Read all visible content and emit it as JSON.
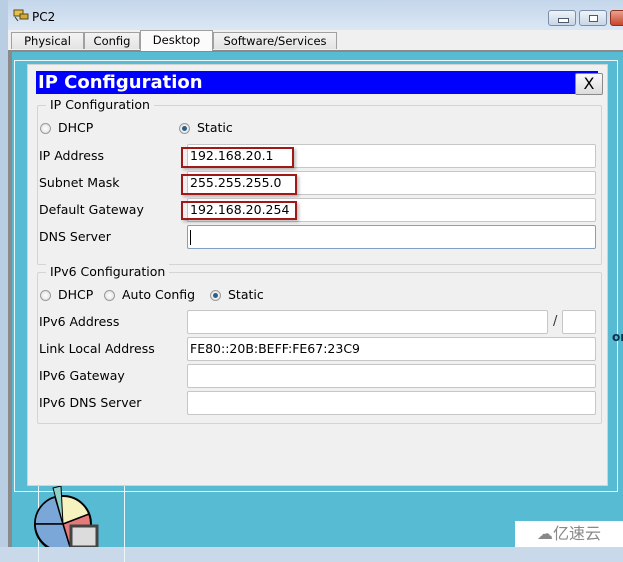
{
  "window": {
    "title": "PC2",
    "icon": "pc-device-icon",
    "controls": [
      "minimize",
      "maximize",
      "close"
    ]
  },
  "tabs": [
    {
      "label": "Physical",
      "active": false
    },
    {
      "label": "Config",
      "active": false
    },
    {
      "label": "Desktop",
      "active": true
    },
    {
      "label": "Software/Services",
      "active": false
    }
  ],
  "dialog": {
    "title": "IP Configuration",
    "close_label": "X",
    "ipv4": {
      "legend": "IP Configuration",
      "mode_options": [
        {
          "label": "DHCP",
          "selected": false
        },
        {
          "label": "Static",
          "selected": true
        }
      ],
      "fields": [
        {
          "label": "IP Address",
          "value": "192.168.20.1",
          "highlighted": true
        },
        {
          "label": "Subnet Mask",
          "value": "255.255.255.0",
          "highlighted": true
        },
        {
          "label": "Default Gateway",
          "value": "192.168.20.254",
          "highlighted": true
        },
        {
          "label": "DNS Server",
          "value": "",
          "highlighted": false,
          "focused": true
        }
      ]
    },
    "ipv6": {
      "legend": "IPv6 Configuration",
      "mode_options": [
        {
          "label": "DHCP",
          "selected": false
        },
        {
          "label": "Auto Config",
          "selected": false
        },
        {
          "label": "Static",
          "selected": true
        }
      ],
      "fields": [
        {
          "label": "IPv6 Address",
          "value": "",
          "prefix_separator": "/",
          "prefix_value": ""
        },
        {
          "label": "Link Local Address",
          "value": "FE80::20B:BEFF:FE67:23C9"
        },
        {
          "label": "IPv6 Gateway",
          "value": ""
        },
        {
          "label": "IPv6 DNS Server",
          "value": ""
        }
      ]
    }
  },
  "background": {
    "partial_label": "or",
    "app_icon": "pie-chart-icon"
  },
  "watermark": {
    "text": "亿速云",
    "icon": "cloud-logo-icon"
  },
  "colors": {
    "dialog_header": "#0000ff",
    "desktop_bg": "#56bbd3",
    "highlight_box": "#a01818"
  }
}
